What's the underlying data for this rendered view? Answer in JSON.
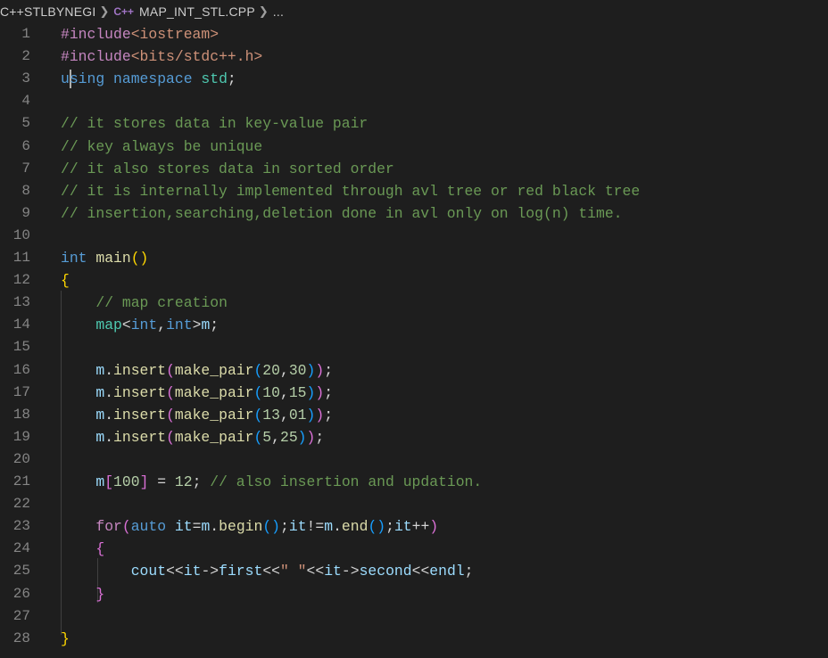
{
  "breadcrumb": {
    "folder": "C++STLBYNEGI",
    "file_icon": "c++-file-icon",
    "file_icon_glyph": "C++",
    "file": "MAP_INT_STL.CPP",
    "more": "..."
  },
  "editor": {
    "line_numbers": [
      "1",
      "2",
      "3",
      "4",
      "5",
      "6",
      "7",
      "8",
      "9",
      "10",
      "11",
      "12",
      "13",
      "14",
      "15",
      "16",
      "17",
      "18",
      "19",
      "20",
      "21",
      "22",
      "23",
      "24",
      "25",
      "26",
      "27",
      "28"
    ],
    "lines": [
      [
        {
          "t": "#include",
          "c": "pp"
        },
        {
          "t": "<iostream>",
          "c": "str"
        }
      ],
      [
        {
          "t": "#include",
          "c": "pp"
        },
        {
          "t": "<bits/stdc++.h>",
          "c": "str"
        }
      ],
      [
        {
          "t": "using",
          "c": "kw"
        },
        {
          "t": " ",
          "c": "plain"
        },
        {
          "t": "namespace",
          "c": "kw"
        },
        {
          "t": " ",
          "c": "plain"
        },
        {
          "t": "std",
          "c": "ns"
        },
        {
          "t": ";",
          "c": "plain"
        }
      ],
      [],
      [
        {
          "t": "// it stores data in key-value pair",
          "c": "cmt"
        }
      ],
      [
        {
          "t": "// key always be unique",
          "c": "cmt"
        }
      ],
      [
        {
          "t": "// it also stores data in sorted order",
          "c": "cmt"
        }
      ],
      [
        {
          "t": "// it is internally implemented through avl tree or red black tree",
          "c": "cmt"
        }
      ],
      [
        {
          "t": "// insertion,searching,deletion done in avl only on log(n) time.",
          "c": "cmt"
        }
      ],
      [],
      [
        {
          "t": "int",
          "c": "kw"
        },
        {
          "t": " ",
          "c": "plain"
        },
        {
          "t": "main",
          "c": "fn"
        },
        {
          "t": "()",
          "c": "b1"
        }
      ],
      [
        {
          "t": "{",
          "c": "b1"
        }
      ],
      [
        {
          "t": "    ",
          "c": "plain"
        },
        {
          "t": "// map creation",
          "c": "cmt"
        }
      ],
      [
        {
          "t": "    ",
          "c": "plain"
        },
        {
          "t": "map",
          "c": "ns"
        },
        {
          "t": "<",
          "c": "plain"
        },
        {
          "t": "int",
          "c": "kw"
        },
        {
          "t": ",",
          "c": "plain"
        },
        {
          "t": "int",
          "c": "kw"
        },
        {
          "t": ">",
          "c": "plain"
        },
        {
          "t": "m",
          "c": "var"
        },
        {
          "t": ";",
          "c": "plain"
        }
      ],
      [],
      [
        {
          "t": "    ",
          "c": "plain"
        },
        {
          "t": "m",
          "c": "var"
        },
        {
          "t": ".",
          "c": "plain"
        },
        {
          "t": "insert",
          "c": "fn"
        },
        {
          "t": "(",
          "c": "b2"
        },
        {
          "t": "make_pair",
          "c": "fn"
        },
        {
          "t": "(",
          "c": "b3"
        },
        {
          "t": "20",
          "c": "num"
        },
        {
          "t": ",",
          "c": "plain"
        },
        {
          "t": "30",
          "c": "num"
        },
        {
          "t": ")",
          "c": "b3"
        },
        {
          "t": ")",
          "c": "b2"
        },
        {
          "t": ";",
          "c": "plain"
        }
      ],
      [
        {
          "t": "    ",
          "c": "plain"
        },
        {
          "t": "m",
          "c": "var"
        },
        {
          "t": ".",
          "c": "plain"
        },
        {
          "t": "insert",
          "c": "fn"
        },
        {
          "t": "(",
          "c": "b2"
        },
        {
          "t": "make_pair",
          "c": "fn"
        },
        {
          "t": "(",
          "c": "b3"
        },
        {
          "t": "10",
          "c": "num"
        },
        {
          "t": ",",
          "c": "plain"
        },
        {
          "t": "15",
          "c": "num"
        },
        {
          "t": ")",
          "c": "b3"
        },
        {
          "t": ")",
          "c": "b2"
        },
        {
          "t": ";",
          "c": "plain"
        }
      ],
      [
        {
          "t": "    ",
          "c": "plain"
        },
        {
          "t": "m",
          "c": "var"
        },
        {
          "t": ".",
          "c": "plain"
        },
        {
          "t": "insert",
          "c": "fn"
        },
        {
          "t": "(",
          "c": "b2"
        },
        {
          "t": "make_pair",
          "c": "fn"
        },
        {
          "t": "(",
          "c": "b3"
        },
        {
          "t": "13",
          "c": "num"
        },
        {
          "t": ",",
          "c": "plain"
        },
        {
          "t": "01",
          "c": "num"
        },
        {
          "t": ")",
          "c": "b3"
        },
        {
          "t": ")",
          "c": "b2"
        },
        {
          "t": ";",
          "c": "plain"
        }
      ],
      [
        {
          "t": "    ",
          "c": "plain"
        },
        {
          "t": "m",
          "c": "var"
        },
        {
          "t": ".",
          "c": "plain"
        },
        {
          "t": "insert",
          "c": "fn"
        },
        {
          "t": "(",
          "c": "b2"
        },
        {
          "t": "make_pair",
          "c": "fn"
        },
        {
          "t": "(",
          "c": "b3"
        },
        {
          "t": "5",
          "c": "num"
        },
        {
          "t": ",",
          "c": "plain"
        },
        {
          "t": "25",
          "c": "num"
        },
        {
          "t": ")",
          "c": "b3"
        },
        {
          "t": ")",
          "c": "b2"
        },
        {
          "t": ";",
          "c": "plain"
        }
      ],
      [],
      [
        {
          "t": "    ",
          "c": "plain"
        },
        {
          "t": "m",
          "c": "var"
        },
        {
          "t": "[",
          "c": "b2"
        },
        {
          "t": "100",
          "c": "num"
        },
        {
          "t": "]",
          "c": "b2"
        },
        {
          "t": " = ",
          "c": "plain"
        },
        {
          "t": "12",
          "c": "num"
        },
        {
          "t": "; ",
          "c": "plain"
        },
        {
          "t": "// also insertion and updation.",
          "c": "cmt"
        }
      ],
      [],
      [
        {
          "t": "    ",
          "c": "plain"
        },
        {
          "t": "for",
          "c": "ctl"
        },
        {
          "t": "(",
          "c": "b2"
        },
        {
          "t": "auto",
          "c": "kw"
        },
        {
          "t": " ",
          "c": "plain"
        },
        {
          "t": "it",
          "c": "var"
        },
        {
          "t": "=",
          "c": "plain"
        },
        {
          "t": "m",
          "c": "var"
        },
        {
          "t": ".",
          "c": "plain"
        },
        {
          "t": "begin",
          "c": "fn"
        },
        {
          "t": "()",
          "c": "b3"
        },
        {
          "t": ";",
          "c": "plain"
        },
        {
          "t": "it",
          "c": "var"
        },
        {
          "t": "!=",
          "c": "plain"
        },
        {
          "t": "m",
          "c": "var"
        },
        {
          "t": ".",
          "c": "plain"
        },
        {
          "t": "end",
          "c": "fn"
        },
        {
          "t": "()",
          "c": "b3"
        },
        {
          "t": ";",
          "c": "plain"
        },
        {
          "t": "it",
          "c": "var"
        },
        {
          "t": "++",
          "c": "plain"
        },
        {
          "t": ")",
          "c": "b2"
        }
      ],
      [
        {
          "t": "    ",
          "c": "plain"
        },
        {
          "t": "{",
          "c": "b2"
        }
      ],
      [
        {
          "t": "        ",
          "c": "plain"
        },
        {
          "t": "cout",
          "c": "var"
        },
        {
          "t": "<<",
          "c": "plain"
        },
        {
          "t": "it",
          "c": "var"
        },
        {
          "t": "->",
          "c": "plain"
        },
        {
          "t": "first",
          "c": "var"
        },
        {
          "t": "<<",
          "c": "plain"
        },
        {
          "t": "\" \"",
          "c": "str"
        },
        {
          "t": "<<",
          "c": "plain"
        },
        {
          "t": "it",
          "c": "var"
        },
        {
          "t": "->",
          "c": "plain"
        },
        {
          "t": "second",
          "c": "var"
        },
        {
          "t": "<<",
          "c": "plain"
        },
        {
          "t": "endl",
          "c": "var"
        },
        {
          "t": ";",
          "c": "plain"
        }
      ],
      [
        {
          "t": "    ",
          "c": "plain"
        },
        {
          "t": "}",
          "c": "b2"
        }
      ],
      [],
      [
        {
          "t": "}",
          "c": "b1"
        }
      ]
    ]
  }
}
